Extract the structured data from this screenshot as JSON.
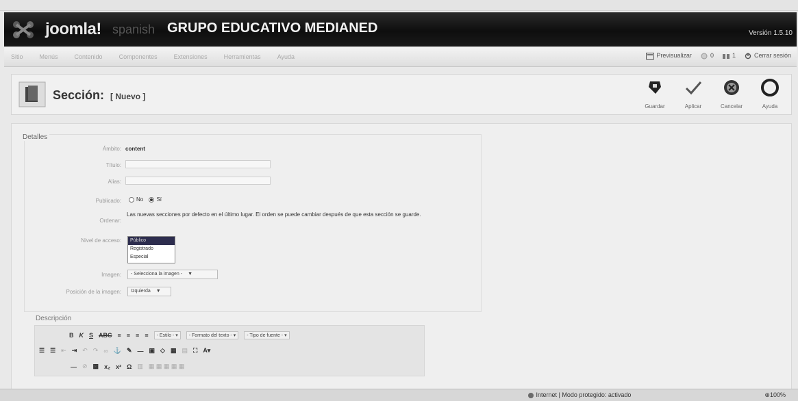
{
  "header": {
    "brand": "joomla!",
    "brand_sub": "spanish",
    "site_name": "GRUPO EDUCATIVO MEDIANED",
    "version": "Versión 1.5.10"
  },
  "menu": {
    "items": [
      "Sitio",
      "Menús",
      "Contenido",
      "Componentes",
      "Extensiones",
      "Herramientas",
      "Ayuda"
    ],
    "preview": "Previsualizar",
    "messages": "0",
    "users": "1",
    "logout": "Cerrar sesión"
  },
  "toolbar": {
    "title": "Sección:",
    "subtitle": "[ Nuevo ]",
    "save": "Guardar",
    "apply": "Aplicar",
    "cancel": "Cancelar",
    "help": "Ayuda"
  },
  "form": {
    "legend": "Detalles",
    "scope_label": "Ámbito:",
    "scope_value": "content",
    "title_label": "Título:",
    "alias_label": "Alias:",
    "published_label": "Publicado:",
    "published_no": "No",
    "published_yes": "Sí",
    "order_label": "Ordenar:",
    "order_text": "Las nuevas secciones por defecto en el último lugar. El orden se puede cambiar después de que esta sección se guarde.",
    "access_label": "Nivel de acceso:",
    "access_options": [
      "Público",
      "Registrado",
      "Especial"
    ],
    "image_label": "Imagen:",
    "image_value": "- Selecciona la imagen -",
    "image_pos_label": "Posición de la imagen:",
    "image_pos_value": "Izquierda"
  },
  "editor": {
    "legend": "Descripción",
    "style": "- Estilo -",
    "format": "- Formato del texto -",
    "font": "- Tipo de fuente -"
  },
  "status": {
    "zone": "Internet | Modo protegido: activado",
    "zoom": "100%"
  }
}
